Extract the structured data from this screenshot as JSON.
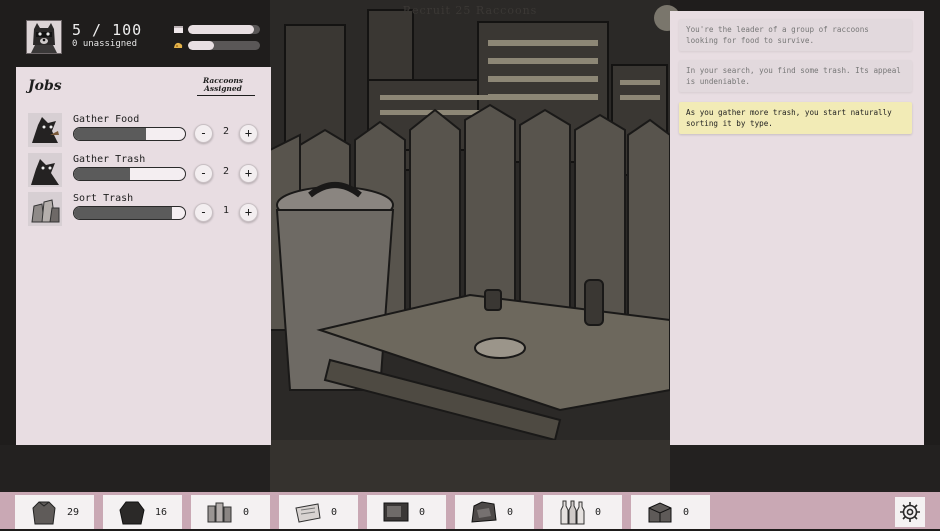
{
  "scene": {
    "title": "Recruit 25 Raccoons"
  },
  "header": {
    "population": "5 / 100",
    "unassigned": "0 unassigned",
    "resources": [
      {
        "icon": "trash-icon",
        "level": 0.92
      },
      {
        "icon": "food-icon",
        "level": 0.36
      }
    ]
  },
  "jobs": {
    "title": "Jobs",
    "assigned_header_line1": "Raccoons",
    "assigned_header_line2": "Assigned",
    "minus_label": "-",
    "plus_label": "+",
    "items": [
      {
        "name": "Gather Food",
        "progress": 0.65,
        "assigned": "2",
        "icon": "raccoon-food-icon"
      },
      {
        "name": "Gather Trash",
        "progress": 0.5,
        "assigned": "2",
        "icon": "raccoon-trash-icon"
      },
      {
        "name": "Sort Trash",
        "progress": 0.88,
        "assigned": "1",
        "icon": "trash-bags-icon"
      }
    ]
  },
  "log": {
    "messages": [
      {
        "text": "You're the leader of a group of raccoons looking for food to survive.",
        "highlight": false
      },
      {
        "text": "In your search, you find some trash. Its appeal is undeniable.",
        "highlight": false
      },
      {
        "text": "As you gather more trash, you start naturally sorting it by type.",
        "highlight": true
      }
    ]
  },
  "inventory": [
    {
      "icon": "garbage-bag-icon",
      "count": "29"
    },
    {
      "icon": "black-bag-icon",
      "count": "16"
    },
    {
      "icon": "cans-icon",
      "count": "0"
    },
    {
      "icon": "paper-icon",
      "count": "0"
    },
    {
      "icon": "electronics-icon",
      "count": "0"
    },
    {
      "icon": "scrap-icon",
      "count": "0"
    },
    {
      "icon": "bottles-icon",
      "count": "0"
    },
    {
      "icon": "box-icon",
      "count": "0"
    }
  ],
  "colors": {
    "panel": "#e8dde2",
    "inventory_bar": "#c9a8b4",
    "highlight": "#f2ebb6"
  }
}
